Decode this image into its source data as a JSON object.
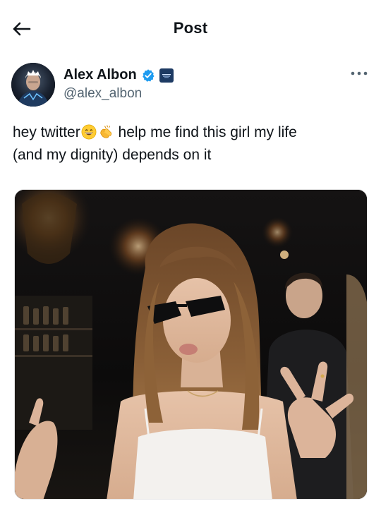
{
  "header": {
    "title": "Post",
    "back_icon": "arrow-left-icon"
  },
  "author": {
    "display_name": "Alex Albon",
    "handle": "@alex_albon",
    "verified_icon": "verified-badge-icon",
    "affiliate_icon": "williams-affiliate-badge",
    "more_icon": "more-horizontal-icon"
  },
  "tweet": {
    "line1_part1": "hey twitter",
    "line1_part2": " help me find this girl my life",
    "line2": "(and my dignity) depends on it",
    "emojis": [
      "grinning-face-emoji",
      "clapping-hands-emoji"
    ]
  },
  "media": {
    "description_icon": "photo",
    "colors": {
      "accent": "#1d9bf0",
      "text": "#0f1419",
      "muted": "#536471"
    }
  }
}
